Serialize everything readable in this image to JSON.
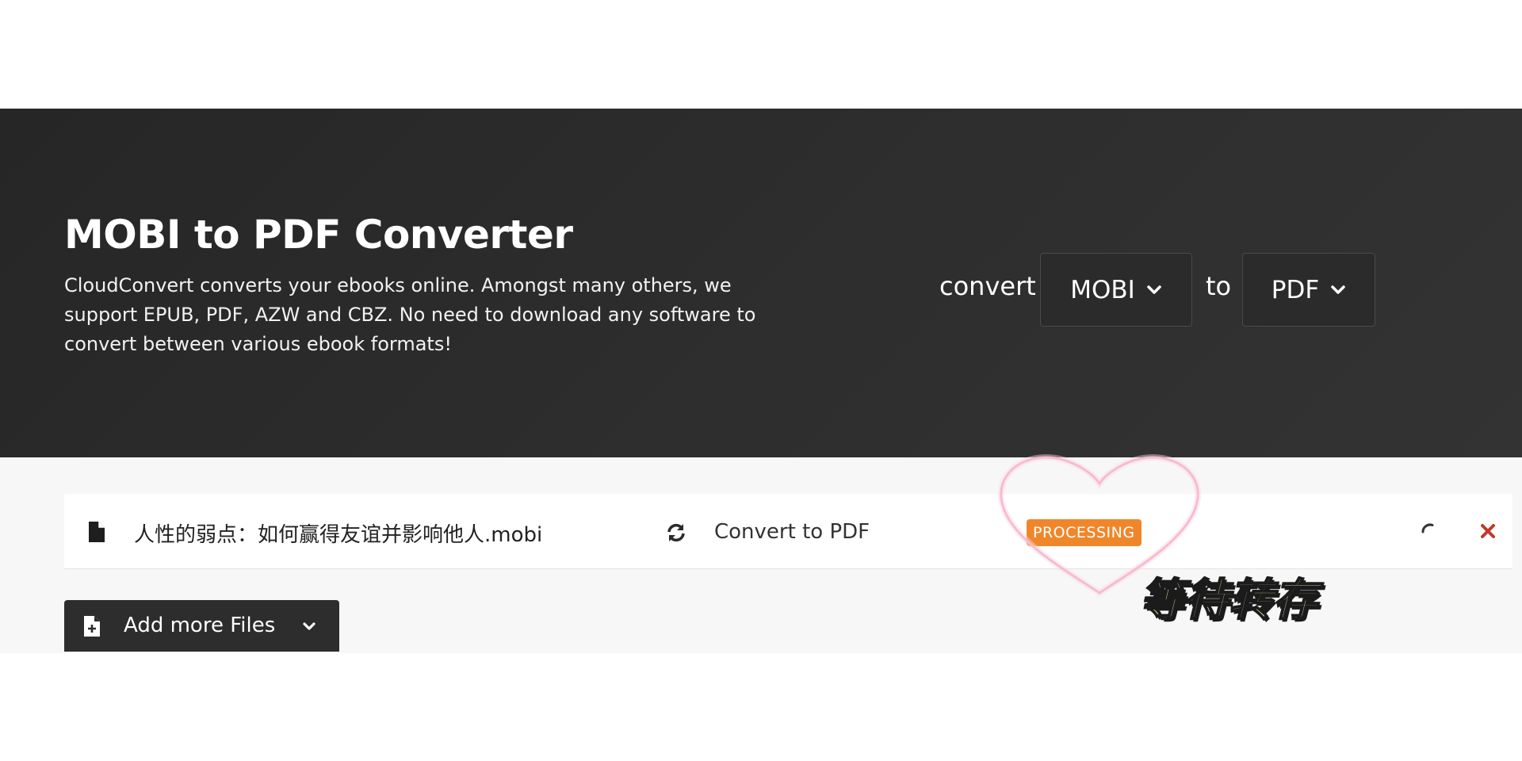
{
  "hero": {
    "title": "MOBI to PDF Converter",
    "description": "CloudConvert converts your ebooks online. Amongst many others, we support EPUB, PDF, AZW and CBZ. No need to download any software to convert between various ebook formats!",
    "convert_word": "convert",
    "to_word": "to",
    "from_format": "MOBI",
    "to_format": "PDF"
  },
  "file": {
    "name": "人性的弱点：如何赢得友谊并影响他人.mobi",
    "action": "Convert to PDF",
    "status": "PROCESSING"
  },
  "add_files": {
    "label": "Add more Files"
  },
  "overlay": {
    "caption": "等待转存"
  },
  "colors": {
    "hero_bg": "#2a2a2a",
    "status_badge": "#f0862a",
    "remove": "#c0392b",
    "heart_outline": "#f4a6be"
  },
  "icons": [
    "file-icon",
    "sync-icon",
    "spinner-icon",
    "close-icon",
    "file-plus-icon",
    "chevron-down-icon",
    "heart-icon"
  ]
}
